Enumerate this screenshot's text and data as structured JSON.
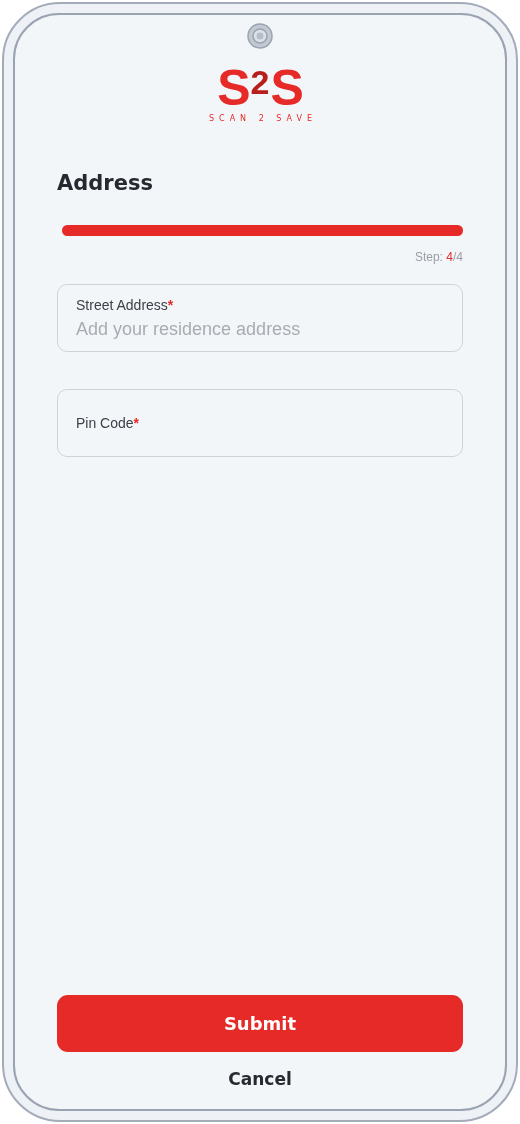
{
  "logo": {
    "mark_left": "S",
    "mark_middle": "2",
    "mark_right": "S",
    "tagline": "SCAN 2 SAVE"
  },
  "title": "Address",
  "progress": {
    "level": 1
  },
  "step": {
    "prefix": "Step: ",
    "current": "4",
    "total": "/4"
  },
  "fields": [
    {
      "label": "Street Address",
      "required_mark": "*",
      "placeholder": "Add your residence address"
    },
    {
      "label": "Pin Code",
      "required_mark": "*"
    }
  ],
  "buttons": {
    "primary": "Submit",
    "secondary": "Cancel"
  }
}
